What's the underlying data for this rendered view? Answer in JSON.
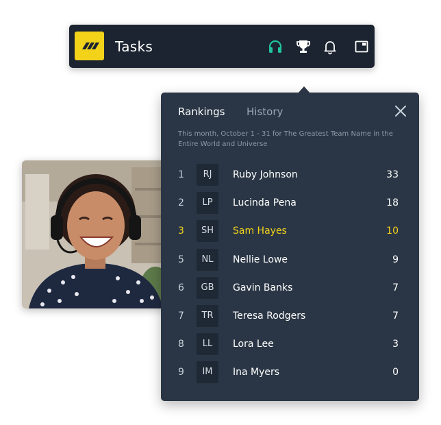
{
  "topbar": {
    "title": "Tasks",
    "icons": [
      "headset-icon",
      "trophy-icon",
      "bell-icon",
      "window-icon"
    ],
    "colors": {
      "background": "#1b2430",
      "logo": "#f3d21a",
      "headset": "#21c3a0"
    }
  },
  "photo": {
    "description_icon": "person-photo"
  },
  "rankings_panel": {
    "tabs": [
      {
        "label": "Rankings",
        "active": true
      },
      {
        "label": "History",
        "active": false
      }
    ],
    "subtitle": "This month, October 1 - 31 for The Greatest Team Name in the Entire World and Universe",
    "highlight_color": "#f3d21a",
    "rows": [
      {
        "rank": "1",
        "initials": "RJ",
        "name": "Ruby Johnson",
        "score": "33",
        "highlight": false
      },
      {
        "rank": "2",
        "initials": "LP",
        "name": "Lucinda Pena",
        "score": "18",
        "highlight": false
      },
      {
        "rank": "3",
        "initials": "SH",
        "name": "Sam Hayes",
        "score": "10",
        "highlight": true
      },
      {
        "rank": "5",
        "initials": "NL",
        "name": "Nellie Lowe",
        "score": "9",
        "highlight": false
      },
      {
        "rank": "6",
        "initials": "GB",
        "name": "Gavin Banks",
        "score": "7",
        "highlight": false
      },
      {
        "rank": "7",
        "initials": "TR",
        "name": "Teresa Rodgers",
        "score": "7",
        "highlight": false
      },
      {
        "rank": "8",
        "initials": "LL",
        "name": "Lora Lee",
        "score": "3",
        "highlight": false
      },
      {
        "rank": "9",
        "initials": "IM",
        "name": "Ina Myers",
        "score": "0",
        "highlight": false
      }
    ]
  }
}
